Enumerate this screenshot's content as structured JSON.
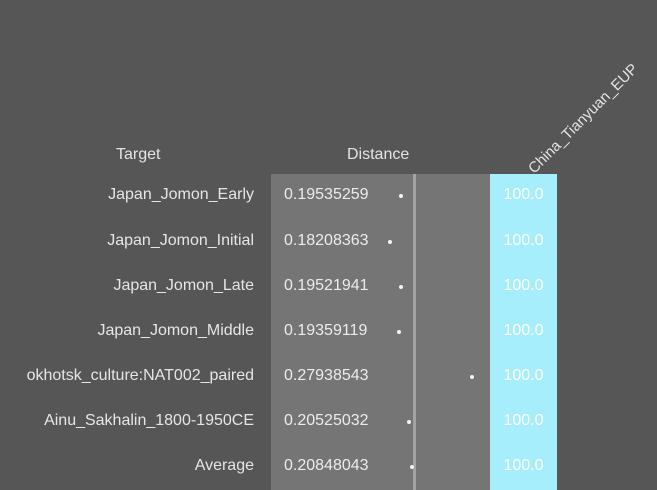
{
  "headers": {
    "target": "Target",
    "distance": "Distance",
    "population": "China_Tianyuan_EUP"
  },
  "rows": [
    {
      "target": "Japan_Jomon_Early",
      "distance": "0.19535259",
      "distance_value": 0.19535259,
      "percent": "100.0"
    },
    {
      "target": "Japan_Jomon_Initial",
      "distance": "0.18208363",
      "distance_value": 0.18208363,
      "percent": "100.0"
    },
    {
      "target": "Japan_Jomon_Late",
      "distance": "0.19521941",
      "distance_value": 0.19521941,
      "percent": "100.0"
    },
    {
      "target": "Japan_Jomon_Middle",
      "distance": "0.19359119",
      "distance_value": 0.19359119,
      "percent": "100.0"
    },
    {
      "target": "okhotsk_culture:NAT002_paired",
      "distance": "0.27938543",
      "distance_value": 0.27938543,
      "percent": "100.0"
    },
    {
      "target": "Ainu_Sakhalin_1800-1950CE",
      "distance": "0.20525032",
      "distance_value": 0.20525032,
      "percent": "100.0"
    },
    {
      "target": "Average",
      "distance": "0.20848043",
      "distance_value": 0.20848043,
      "percent": "100.0"
    }
  ],
  "colors": {
    "background": "#565656",
    "distance_panel": "#757575",
    "population_column": "#a6eefb",
    "dot": "#f4f4f4"
  }
}
